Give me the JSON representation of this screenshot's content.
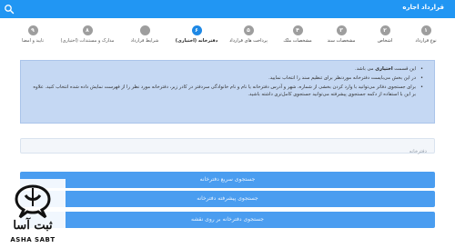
{
  "header": {
    "title": "قرارداد اجاره",
    "search_icon": "search-icon"
  },
  "stepper": {
    "steps": [
      {
        "num": "۱",
        "label": "نوع قرارداد"
      },
      {
        "num": "۲",
        "label": "اشخاص"
      },
      {
        "num": "۳",
        "label": "مشخصات سند"
      },
      {
        "num": "۴",
        "label": "مشخصات ملک"
      },
      {
        "num": "۵",
        "label": "پرداخت های قرارداد"
      },
      {
        "num": "۶",
        "label": "دفترخانه (اختیاری)"
      },
      {
        "num": "",
        "label": "شرایط قرارداد"
      },
      {
        "num": "۸",
        "label": "مدارک و مستندات (اختیاری)"
      },
      {
        "num": "۹",
        "label": "تایید و امضا"
      }
    ],
    "active_index": 5
  },
  "info": {
    "line1_prefix": "این قسمت ",
    "line1_bold": "اختیاری",
    "line1_suffix": " می باشد.",
    "line2": "در این بخش می‌بایست دفترخانه موردنظر برای تنظیم سند را انتخاب نمایید.",
    "line3": "برای جستجوی دفاتر می‌توانید با وارد کردن بخشی از شماره، شهر و آدرس دفترخانه یا نام و نام خانوادگی سردفتر در کادر زیر، دفترخانه مورد نظر را از فهرست نمایش داده شده انتخاب کنید. علاوه بر این با استفاده از دکمه جستجوی پیشرفته می‌توانید جستجوی کامل‌تری داشته باشید."
  },
  "search": {
    "placeholder": "دفترخانه"
  },
  "buttons": {
    "quick": "جستجوی سریع دفترخانه",
    "advanced": "جستجوی پیشرفته دفترخانه",
    "map": "جستجوی دفترخانه بر روی نقشه"
  },
  "logo": {
    "fa": "ثبت آسا",
    "en": "ASHA SABT"
  },
  "colors": {
    "header": "#2196f3",
    "active_step": "#1e88e5",
    "inactive_step": "#9e9e9e",
    "info_bg": "#c5d8f3",
    "button": "#4a9df0"
  }
}
